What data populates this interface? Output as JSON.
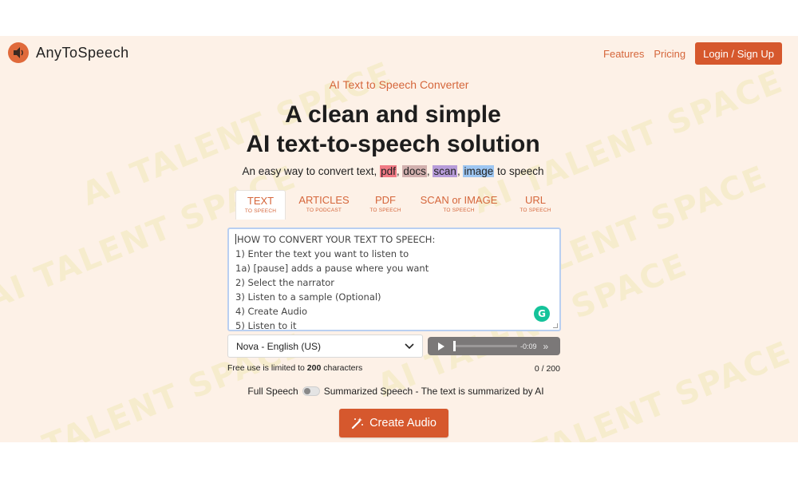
{
  "header": {
    "brand": "AnyToSpeech",
    "nav": [
      {
        "label": "Features"
      },
      {
        "label": "Pricing"
      }
    ],
    "login_label": "Login / Sign Up"
  },
  "hero": {
    "eyebrow": "AI Text to Speech Converter",
    "title_line1": "A clean and simple",
    "title_line2": "AI text-to-speech solution",
    "subtitle_prefix": "An easy way to convert text, ",
    "subtitle_pdf": "pdf",
    "subtitle_docs": "docs",
    "subtitle_scan": "scan",
    "subtitle_image": "image",
    "subtitle_suffix": " to speech",
    "sep": ", "
  },
  "tabs": [
    {
      "title": "TEXT",
      "sub": "TO SPEECH",
      "active": true
    },
    {
      "title": "ARTICLES",
      "sub": "TO PODCAST",
      "active": false
    },
    {
      "title": "PDF",
      "sub": "TO SPEECH",
      "active": false
    },
    {
      "title": "SCAN or IMAGE",
      "sub": "TO SPEECH",
      "active": false
    },
    {
      "title": "URL",
      "sub": "TO SPEECH",
      "active": false
    }
  ],
  "editor": {
    "placeholder_lines": [
      "HOW TO CONVERT YOUR TEXT TO SPEECH:",
      "1) Enter the text you want to listen to",
      "1a) [pause] adds a pause where you want",
      "2) Select the narrator",
      "3) Listen to a sample (Optional)",
      "4) Create Audio",
      "5) Listen to it"
    ],
    "grammarly_icon": "G"
  },
  "voice": {
    "selected": "Nova - English (US)"
  },
  "player": {
    "time": "-0:09",
    "progress": 0.0
  },
  "limit": {
    "prefix": "Free use is limited to ",
    "value": "200",
    "suffix": " characters",
    "counter": "0 / 200"
  },
  "mode": {
    "left": "Full Speech",
    "right": "Summarized Speech - The text is summarized by AI"
  },
  "cta": {
    "label": "Create Audio"
  },
  "watermark": "AI TALENT SPACE",
  "colors": {
    "accent": "#d6582d",
    "background": "#fdf1e7"
  }
}
